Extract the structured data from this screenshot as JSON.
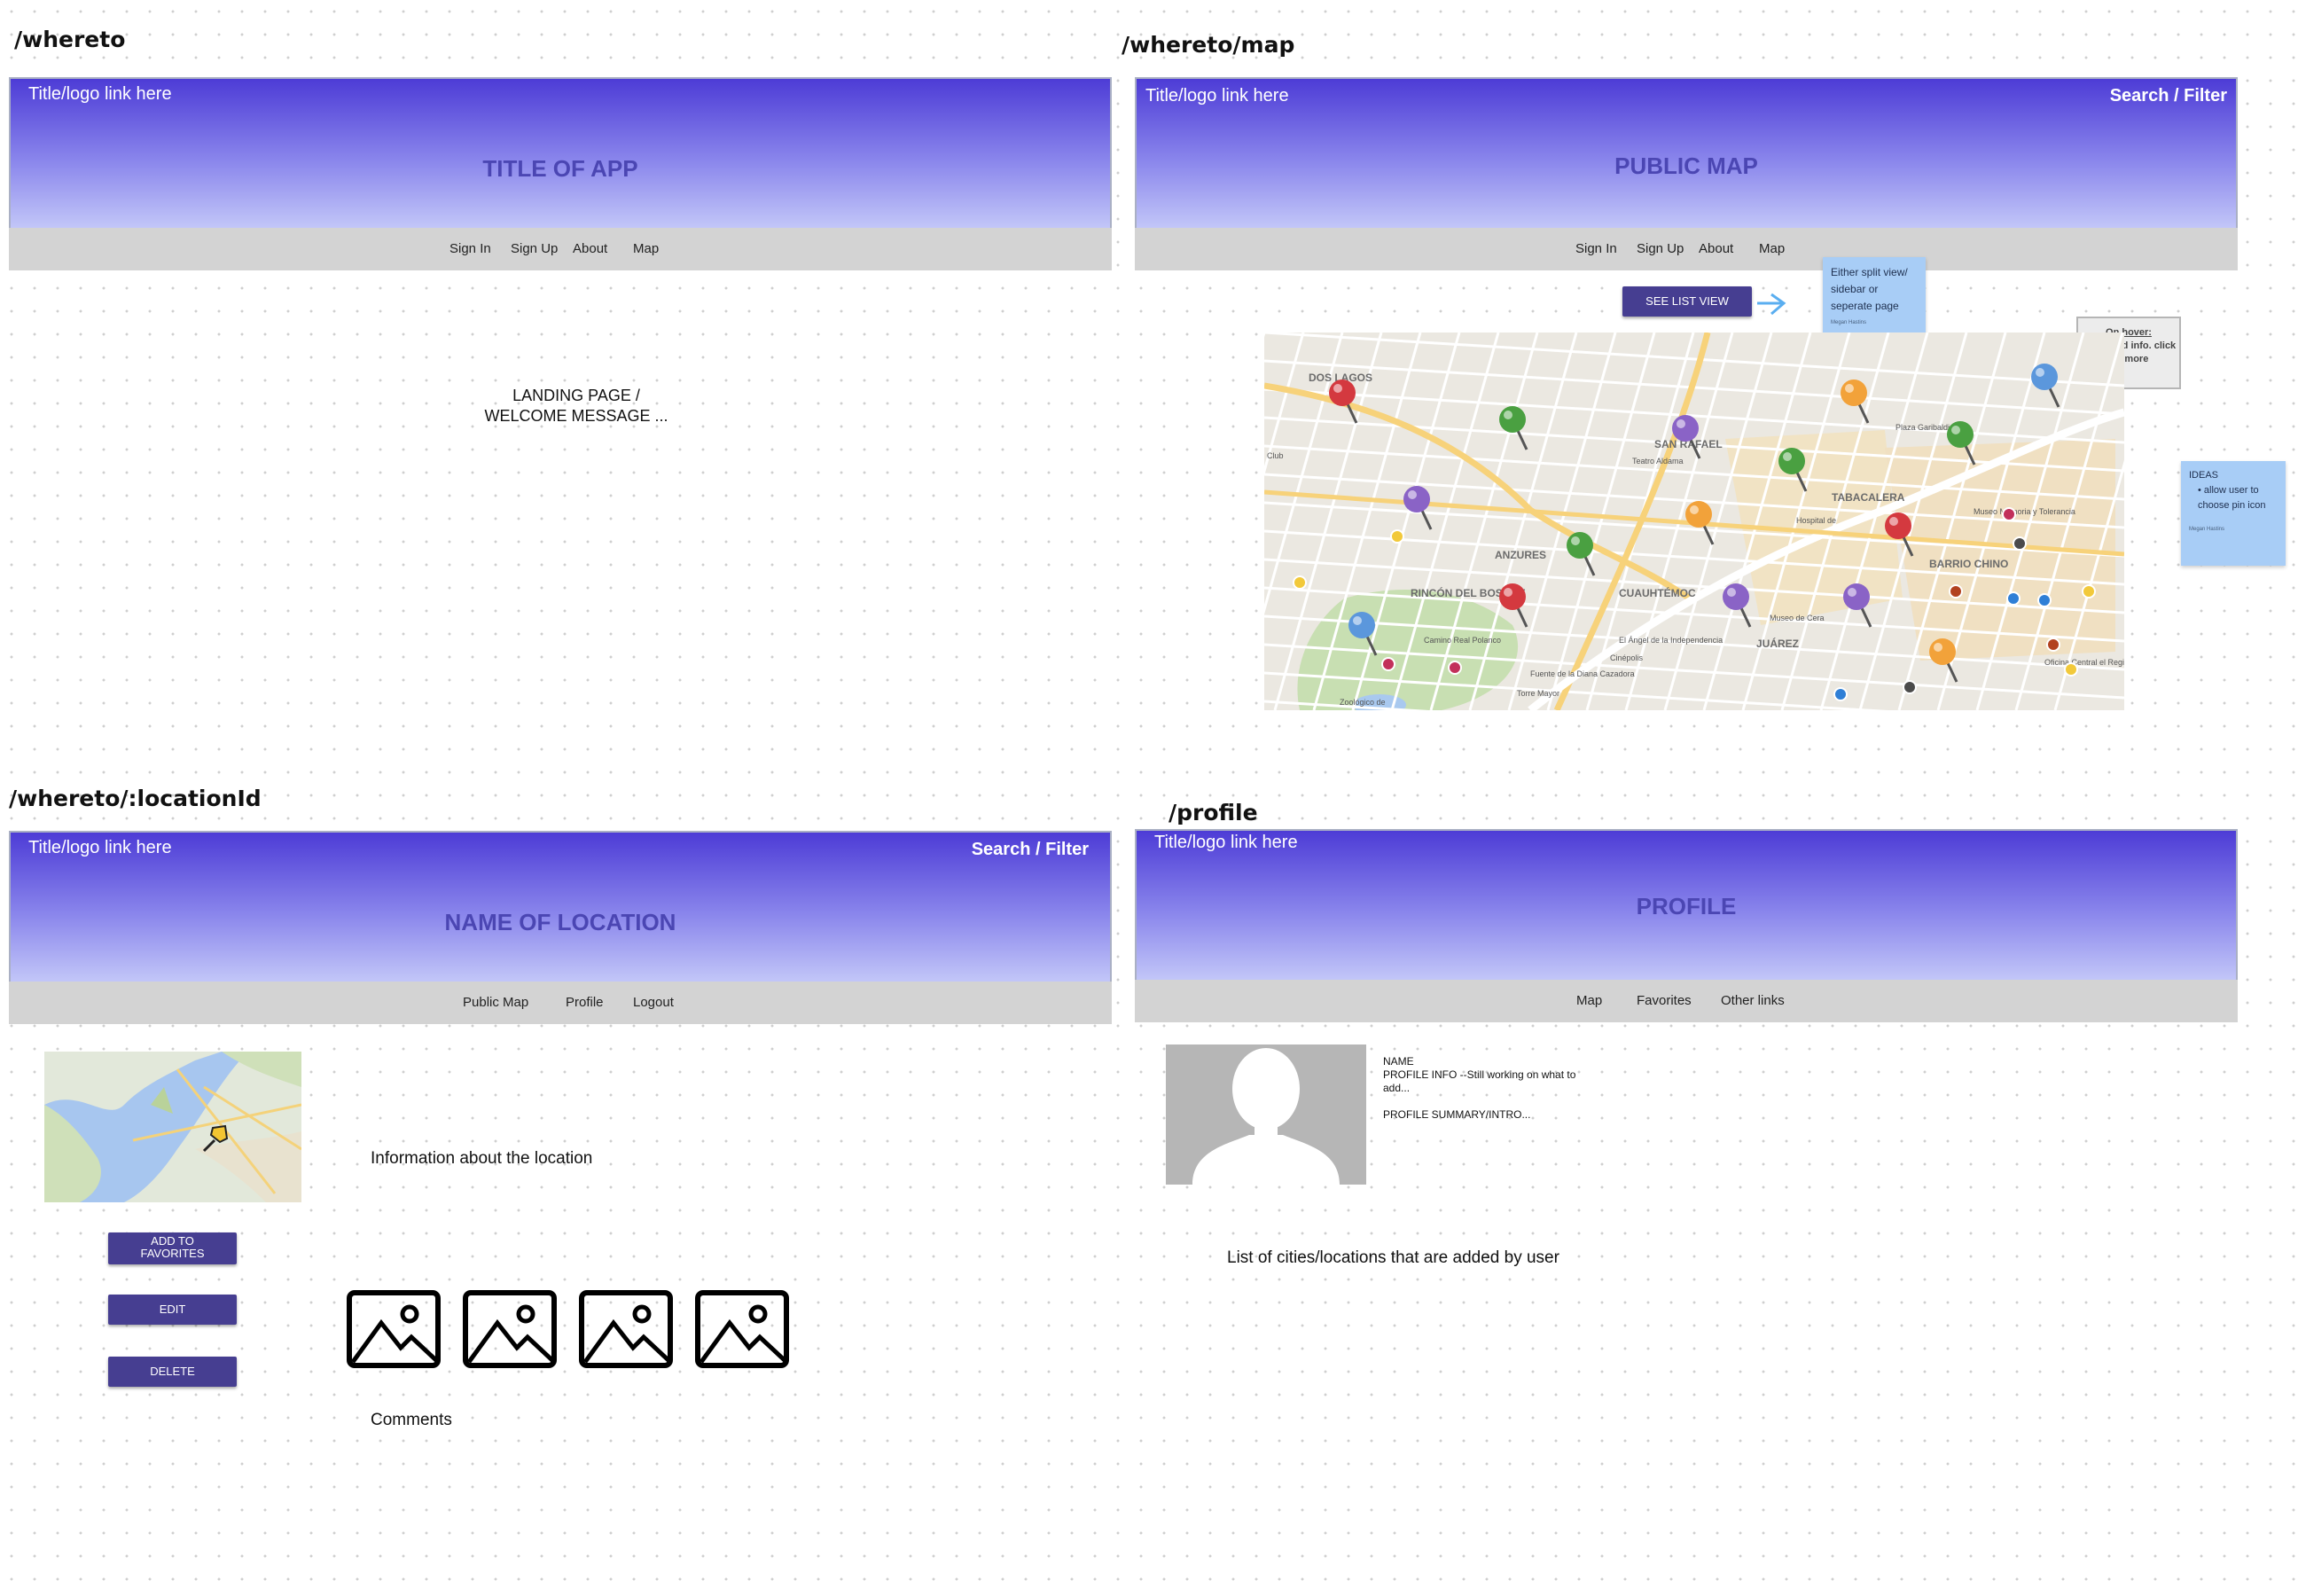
{
  "colors": {
    "header_top": "#4d3cd6",
    "header_bottom": "#c2c6f8",
    "title_text": "#4b46b3",
    "nav_bg": "#d3d3d3",
    "button": "#463e91",
    "sticky": "#a8cdf6"
  },
  "landing": {
    "route": "/whereto",
    "logo": "Title/logo link here",
    "title": "TITLE OF APP",
    "nav": [
      "Sign In",
      "Sign Up",
      "About",
      "Map"
    ],
    "message_line1": "LANDING PAGE /",
    "message_line2": "WELCOME MESSAGE  ..."
  },
  "map_page": {
    "route": "/whereto/map",
    "logo": "Title/logo link here",
    "search": "Search / Filter",
    "title": "PUBLIC MAP",
    "nav": [
      "Sign In",
      "Sign Up",
      "About",
      "Map"
    ],
    "list_button": "SEE LIST VIEW",
    "note_split": "Either split view/ sidebar or seperate page",
    "note_split_author": "Megan Hastins",
    "hover_title": "On hover:",
    "hover_body": "Name and info. click for more",
    "ideas_title": "IDEAS",
    "ideas_item": "allow user to choose pin icon",
    "ideas_author": "Megan Hastins",
    "map_labels": [
      "DOS LAGOS",
      "SAN RAFAEL",
      "TABACALERA",
      "ANZURES",
      "RINCÓN DEL BOSQUE",
      "CUAUHTÉMOC",
      "JUÁREZ",
      "BARRIO CHINO",
      "Plaza Garibaldi",
      "Teatro Aldama",
      "Museo Memoria y Tolerancia",
      "Camino Real Polanco",
      "El Ángel de la Independencia",
      "Fuente de la Diana Cazadora",
      "Museo de Cera",
      "Zoológico de",
      "Club",
      "Oficina Central el Registro Civil",
      "Hospital de",
      "Cinépolis",
      "Torre Mayor"
    ]
  },
  "location": {
    "route": "/whereto/:locationId",
    "logo": "Title/logo link here",
    "search": "Search / Filter",
    "title": "NAME OF LOCATION",
    "nav": [
      "Public Map",
      "Profile",
      "Logout"
    ],
    "add_fav_line1": "ADD TO",
    "add_fav_line2": "FAVORITES",
    "edit": "EDIT",
    "delete": "DELETE",
    "info": "Information about the location",
    "comments": "Comments"
  },
  "profile": {
    "route": "/profile",
    "logo": "Title/logo link here",
    "title": "PROFILE",
    "nav": [
      "Map",
      "Favorites",
      "Other links"
    ],
    "name": "NAME",
    "info_line1": "PROFILE INFO --Still working on what to",
    "info_line2": "add...",
    "summary": "PROFILE SUMMARY/INTRO...",
    "list_text": "List of cities/locations that are added by user"
  }
}
